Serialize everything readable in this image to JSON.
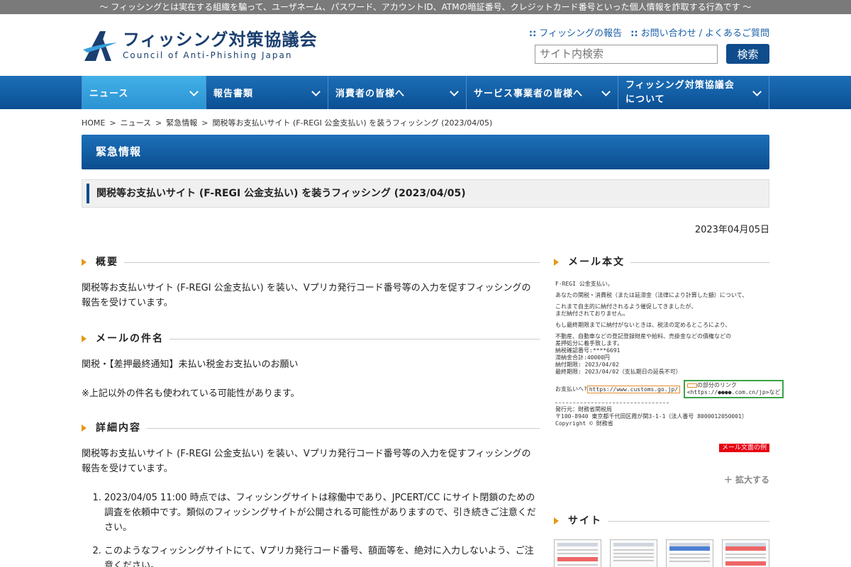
{
  "tagline": "～ フィッシングとは実在する組織を騙って、ユーザネーム、パスワード、アカウントID、ATMの暗証番号、クレジットカード番号といった個人情報を詐取する行為です ～",
  "logo": {
    "jp": "フィッシング対策協議会",
    "en": "Council of Anti-Phishing Japan"
  },
  "head_links": {
    "report": "フィッシングの報告",
    "contact": "お問い合わせ",
    "faq": "よくあるご質問"
  },
  "search": {
    "placeholder": "サイト内検索",
    "button": "検索"
  },
  "nav": [
    {
      "label": "ニュース"
    },
    {
      "label": "報告書類"
    },
    {
      "label": "消費者の皆様へ"
    },
    {
      "label": "サービス事業者の皆様へ"
    },
    {
      "label": "フィッシング対策協議会について",
      "line1": "フィッシング対策協議会",
      "line2": "について"
    }
  ],
  "breadcrumb": [
    "HOME",
    "ニュース",
    "緊急情報",
    "関税等お支払いサイト (F-REGI 公金支払い) を装うフィッシング (2023/04/05)"
  ],
  "section_banner": "緊急情報",
  "page_title": "関税等お支払いサイト (F-REGI 公金支払い) を装うフィッシング (2023/04/05)",
  "date": "2023年04月05日",
  "sections": {
    "overview": {
      "heading": "概要",
      "text": "関税等お支払いサイト (F-REGI 公金支払い) を装い、Vプリカ発行コード番号等の入力を促すフィッシングの報告を受けています。"
    },
    "subject": {
      "heading": "メールの件名",
      "text": "関税・【差押最終通知】未払い税金お支払いのお願い",
      "note": "※上記以外の件名も使われている可能性があります。"
    },
    "detail": {
      "heading": "詳細内容",
      "text": "関税等お支払いサイト (F-REGI 公金支払い) を装い、Vプリカ発行コード番号等の入力を促すフィッシングの報告を受けています。",
      "items": [
        "2023/04/05 11:00 時点では、フィッシングサイトは稼働中であり、JPCERT/CC にサイト閉鎖のための調査を依頼中です。類似のフィッシングサイトが公開される可能性がありますので、引き続きご注意ください。",
        "このようなフィッシングサイトにて、Vプリカ発行コード番号、額面等を、絶対に入力しないよう、ご注意ください。"
      ]
    }
  },
  "sidebar": {
    "mail_heading": "メール本文",
    "mail": {
      "l1": "F-REGI 公金支払い。",
      "l2": "あなたの関税・消費税（または延滞金（法律により計算した額）について、",
      "l3a": "これまで自主的に納付されるよう催促してきましたが、",
      "l3b": "まだ納付されておりません。",
      "l4": "もし最終期限までに納付がないときは、税法の定めるところにより、",
      "l5a": "不動産、自動車などの登記登録財産や給料、売掛金などの債権などの",
      "l5b": "差押処分に着手致します。",
      "l5c": "納税確認番号:****6691",
      "l5d": "滞納金合計:40000円",
      "l5e": "納付期限: 2023/04/02",
      "l5f": "最終期限: 2023/04/02（支払期日の延長不可）",
      "pay_prefix": "お支払いへ?",
      "pay_url": "https://www.customs.go.jp/",
      "link_note1": "の部分のリンク",
      "link_note2": "<https://●●●●.com.cn/jp>など",
      "f1": "発行元：財務省関税局",
      "f2": "〒100-8940 東京都千代田区霞が関3-1-1（法人番号 8000012050001）",
      "f3": "Copyright © 財務省",
      "tag": "メール文面の例"
    },
    "enlarge": "＋ 拡大する",
    "site_heading": "サイト"
  },
  "colors": {
    "nav_blue": "#0b4f93",
    "accent_orange": "#e39a14",
    "tag_red": "#e60012"
  }
}
